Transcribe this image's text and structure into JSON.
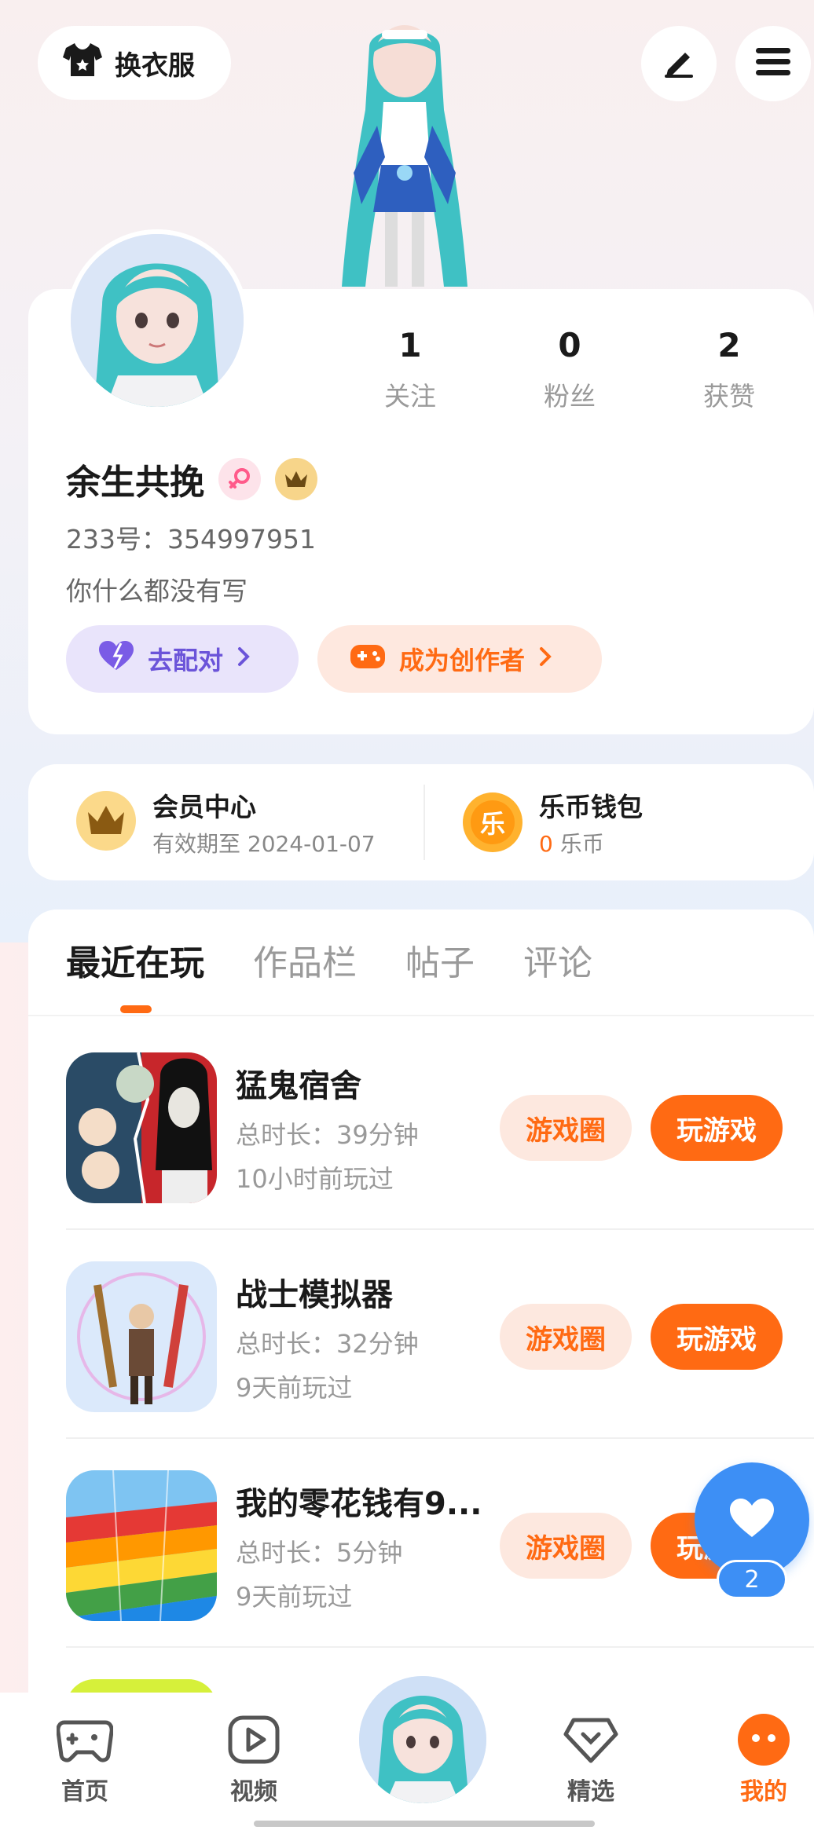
{
  "header": {
    "outfit_button_label": "换衣服",
    "edit_icon": "pencil-icon",
    "menu_icon": "hamburger-menu-icon"
  },
  "profile": {
    "stats": [
      {
        "value": "1",
        "label": "关注"
      },
      {
        "value": "0",
        "label": "粉丝"
      },
      {
        "value": "2",
        "label": "获赞"
      }
    ],
    "username": "余生共挽",
    "id_line": "233号：354997951",
    "bio": "你什么都没有写",
    "match_button": "去配对",
    "creator_button": "成为创作者"
  },
  "vip": {
    "member_title": "会员中心",
    "member_sub": "有效期至 2024-01-07",
    "wallet_title": "乐币钱包",
    "wallet_amount": "0",
    "wallet_unit": "乐币",
    "wallet_coin_char": "乐"
  },
  "tabs": [
    {
      "label": "最近在玩",
      "active": true
    },
    {
      "label": "作品栏",
      "active": false
    },
    {
      "label": "帖子",
      "active": false
    },
    {
      "label": "评论",
      "active": false
    }
  ],
  "games": [
    {
      "title": "猛鬼宿舍",
      "duration": "总时长：39分钟",
      "last_played": "10小时前玩过",
      "circle_btn": "游戏圈",
      "play_btn": "玩游戏"
    },
    {
      "title": "战士模拟器",
      "duration": "总时长：32分钟",
      "last_played": "9天前玩过",
      "circle_btn": "游戏圈",
      "play_btn": "玩游戏"
    },
    {
      "title": "我的零花钱有9...",
      "duration": "总时长：5分钟",
      "last_played": "9天前玩过",
      "circle_btn": "游戏圈",
      "play_btn": "玩游戏"
    }
  ],
  "fab": {
    "count": "2"
  },
  "bottom_nav": [
    {
      "label": "首页"
    },
    {
      "label": "视频"
    },
    {
      "label": "精选"
    },
    {
      "label": "我的"
    }
  ],
  "colors": {
    "accent": "#ff6a13",
    "blue": "#3d8ff5",
    "purple": "#7a5ce6"
  }
}
